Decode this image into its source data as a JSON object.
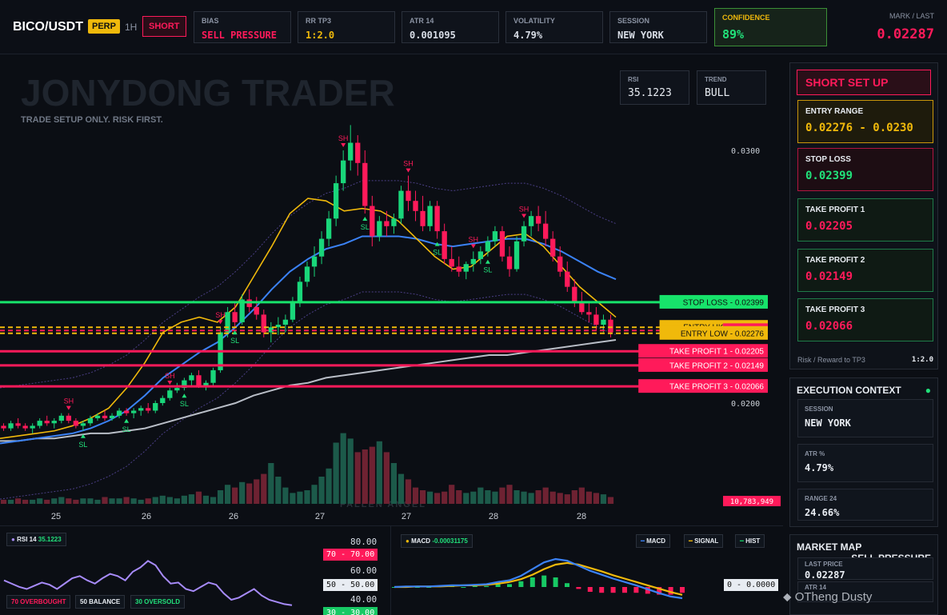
{
  "header": {
    "symbol": "BICO/USDT",
    "perp": "PERP",
    "timeframe": "1H",
    "side": "SHORT",
    "metrics": [
      {
        "label": "BIAS",
        "value": "SELL PRESSURE",
        "color": "#ff1a5a"
      },
      {
        "label": "RR TP3",
        "value": "1:2.0",
        "color": "#f0b90b"
      },
      {
        "label": "ATR 14",
        "value": "0.001095",
        "color": "#e8ecf2"
      },
      {
        "label": "VOLATILITY",
        "value": "4.79%",
        "color": "#e8ecf2"
      },
      {
        "label": "SESSION",
        "value": "NEW YORK",
        "color": "#e8ecf2"
      }
    ],
    "confidence_label": "CONFIDENCE",
    "confidence": "89%",
    "mark_label": "MARK / LAST",
    "mark": "0.02287"
  },
  "watermark": {
    "title": "JONYDONG TRADER",
    "subtitle": "TRADE SETUP ONLY. RISK FIRST.",
    "footer": "FALLEN ANGEL"
  },
  "overlay": {
    "rsi_label": "RSI",
    "rsi": "35.1223",
    "trend_label": "TREND",
    "trend": "BULL"
  },
  "chart_data": {
    "type": "candlestick",
    "y_ticks": [
      "0.0300",
      "0.0200"
    ],
    "x_ticks": [
      "25",
      "26",
      "26",
      "27",
      "27",
      "28",
      "28"
    ],
    "candles_ohlc": [
      [
        0.0191,
        0.0192,
        0.0189,
        0.019
      ],
      [
        0.019,
        0.0193,
        0.0189,
        0.0192
      ],
      [
        0.0192,
        0.0194,
        0.019,
        0.0191
      ],
      [
        0.0191,
        0.0192,
        0.0189,
        0.019
      ],
      [
        0.019,
        0.0192,
        0.0188,
        0.0191
      ],
      [
        0.0191,
        0.0194,
        0.019,
        0.0193
      ],
      [
        0.0193,
        0.0195,
        0.0191,
        0.0192
      ],
      [
        0.0192,
        0.0194,
        0.019,
        0.0193
      ],
      [
        0.0193,
        0.0196,
        0.0192,
        0.0195
      ],
      [
        0.0195,
        0.0196,
        0.0192,
        0.0193
      ],
      [
        0.0193,
        0.0194,
        0.019,
        0.0191
      ],
      [
        0.0191,
        0.0193,
        0.0189,
        0.0192
      ],
      [
        0.0192,
        0.0195,
        0.0191,
        0.0194
      ],
      [
        0.0194,
        0.0196,
        0.0193,
        0.0195
      ],
      [
        0.0195,
        0.0197,
        0.0193,
        0.0194
      ],
      [
        0.0194,
        0.0196,
        0.0193,
        0.0195
      ],
      [
        0.0195,
        0.0198,
        0.0194,
        0.0197
      ],
      [
        0.0197,
        0.0198,
        0.0195,
        0.0196
      ],
      [
        0.0196,
        0.0198,
        0.0194,
        0.0197
      ],
      [
        0.0197,
        0.0199,
        0.0195,
        0.0198
      ],
      [
        0.0198,
        0.02,
        0.0196,
        0.0197
      ],
      [
        0.0197,
        0.0201,
        0.0196,
        0.02
      ],
      [
        0.02,
        0.0203,
        0.0199,
        0.0202
      ],
      [
        0.0202,
        0.0206,
        0.0201,
        0.0205
      ],
      [
        0.0205,
        0.0208,
        0.0204,
        0.0206
      ],
      [
        0.0206,
        0.021,
        0.0205,
        0.0209
      ],
      [
        0.0209,
        0.0212,
        0.0207,
        0.0211
      ],
      [
        0.0211,
        0.0213,
        0.0206,
        0.0207
      ],
      [
        0.0207,
        0.0209,
        0.0205,
        0.0208
      ],
      [
        0.0208,
        0.0214,
        0.0207,
        0.0213
      ],
      [
        0.0213,
        0.023,
        0.0212,
        0.0228
      ],
      [
        0.0228,
        0.0238,
        0.0226,
        0.0236
      ],
      [
        0.0236,
        0.024,
        0.023,
        0.0232
      ],
      [
        0.0232,
        0.0243,
        0.0231,
        0.0241
      ],
      [
        0.0241,
        0.0245,
        0.0236,
        0.0238
      ],
      [
        0.0238,
        0.0242,
        0.0233,
        0.0235
      ],
      [
        0.0235,
        0.0237,
        0.0226,
        0.0228
      ],
      [
        0.0228,
        0.0232,
        0.0224,
        0.023
      ],
      [
        0.023,
        0.0234,
        0.0227,
        0.0231
      ],
      [
        0.0231,
        0.0235,
        0.0228,
        0.0233
      ],
      [
        0.0233,
        0.0242,
        0.0232,
        0.024
      ],
      [
        0.024,
        0.025,
        0.0238,
        0.0248
      ],
      [
        0.0248,
        0.0256,
        0.0246,
        0.0254
      ],
      [
        0.0254,
        0.0262,
        0.025,
        0.0258
      ],
      [
        0.0258,
        0.0268,
        0.0255,
        0.0265
      ],
      [
        0.0265,
        0.0276,
        0.0262,
        0.0273
      ],
      [
        0.0273,
        0.029,
        0.027,
        0.0287
      ],
      [
        0.0287,
        0.03,
        0.0284,
        0.0296
      ],
      [
        0.0296,
        0.031,
        0.0292,
        0.0303
      ],
      [
        0.0303,
        0.0306,
        0.029,
        0.0295
      ],
      [
        0.0295,
        0.03,
        0.0275,
        0.0278
      ],
      [
        0.0278,
        0.0282,
        0.0262,
        0.0266
      ],
      [
        0.0266,
        0.0274,
        0.0264,
        0.0272
      ],
      [
        0.0272,
        0.0276,
        0.0266,
        0.027
      ],
      [
        0.027,
        0.0275,
        0.0267,
        0.0273
      ],
      [
        0.0273,
        0.0286,
        0.0271,
        0.0284
      ],
      [
        0.0284,
        0.029,
        0.0276,
        0.028
      ],
      [
        0.028,
        0.0284,
        0.0272,
        0.0276
      ],
      [
        0.0276,
        0.0282,
        0.0268,
        0.027
      ],
      [
        0.027,
        0.028,
        0.0268,
        0.0278
      ],
      [
        0.0278,
        0.028,
        0.0265,
        0.0268
      ],
      [
        0.0268,
        0.0271,
        0.0255,
        0.0257
      ],
      [
        0.0257,
        0.0262,
        0.0252,
        0.0254
      ],
      [
        0.0254,
        0.0258,
        0.025,
        0.0252
      ],
      [
        0.0252,
        0.0256,
        0.0249,
        0.0255
      ],
      [
        0.0255,
        0.026,
        0.0252,
        0.0257
      ],
      [
        0.0257,
        0.0262,
        0.0255,
        0.026
      ],
      [
        0.026,
        0.0266,
        0.0258,
        0.0264
      ],
      [
        0.0264,
        0.027,
        0.0262,
        0.0268
      ],
      [
        0.0268,
        0.027,
        0.0256,
        0.0258
      ],
      [
        0.0258,
        0.0262,
        0.025,
        0.0253
      ],
      [
        0.0253,
        0.0266,
        0.0252,
        0.0264
      ],
      [
        0.0264,
        0.0272,
        0.0262,
        0.027
      ],
      [
        0.027,
        0.0276,
        0.0266,
        0.0274
      ],
      [
        0.0274,
        0.0278,
        0.0268,
        0.0271
      ],
      [
        0.0271,
        0.0276,
        0.0262,
        0.0265
      ],
      [
        0.0265,
        0.0268,
        0.0256,
        0.0258
      ],
      [
        0.0258,
        0.0262,
        0.025,
        0.0252
      ],
      [
        0.0252,
        0.0256,
        0.0244,
        0.0246
      ],
      [
        0.0246,
        0.0249,
        0.0238,
        0.024
      ],
      [
        0.024,
        0.0244,
        0.0235,
        0.0236
      ],
      [
        0.0236,
        0.024,
        0.0232,
        0.0235
      ],
      [
        0.0235,
        0.0238,
        0.0229,
        0.0231
      ],
      [
        0.0231,
        0.0235,
        0.0228,
        0.0233
      ],
      [
        0.0233,
        0.0235,
        0.0226,
        0.0228
      ]
    ],
    "ema_yellow": [
      0.0186,
      0.0187,
      0.0188,
      0.0189,
      0.0191,
      0.0194,
      0.0198,
      0.0206,
      0.0216,
      0.0228,
      0.0232,
      0.0234,
      0.0232,
      0.0238,
      0.025,
      0.0262,
      0.0275,
      0.0281,
      0.028,
      0.0276,
      0.0277,
      0.0276,
      0.0272,
      0.0265,
      0.0258,
      0.0253,
      0.0254,
      0.026,
      0.0266,
      0.0267,
      0.0262,
      0.0254,
      0.0246,
      0.024,
      0.0234
    ],
    "ema_blue": [
      0.0184,
      0.0185,
      0.0186,
      0.0187,
      0.0188,
      0.019,
      0.0193,
      0.0197,
      0.0203,
      0.021,
      0.0215,
      0.022,
      0.0224,
      0.023,
      0.0237,
      0.0245,
      0.0252,
      0.0257,
      0.0261,
      0.0263,
      0.0266,
      0.0266,
      0.0266,
      0.0265,
      0.0263,
      0.0262,
      0.0263,
      0.0264,
      0.0265,
      0.0265,
      0.0263,
      0.026,
      0.0256,
      0.0252,
      0.0249
    ],
    "ema_gray": [
      0.0185,
      0.0185,
      0.0186,
      0.0186,
      0.0187,
      0.0188,
      0.0188,
      0.0189,
      0.019,
      0.0192,
      0.0194,
      0.0196,
      0.0198,
      0.02,
      0.0203,
      0.0205,
      0.0207,
      0.0208,
      0.021,
      0.0211,
      0.0212,
      0.0213,
      0.0214,
      0.0215,
      0.0216,
      0.0217,
      0.0218,
      0.0219,
      0.0219,
      0.022,
      0.0221,
      0.0222,
      0.0223,
      0.0224,
      0.0225
    ],
    "levels": [
      {
        "label": "STOP LOSS",
        "value": 0.02399,
        "text": "0.02399",
        "color": "#17e36b",
        "style": "solid"
      },
      {
        "label": "ENTRY HIGH",
        "value": 0.023,
        "text": "0.0230",
        "color": "#f0b90b",
        "style": "dashed"
      },
      {
        "label": "",
        "value": 0.02287,
        "text": "0.02287",
        "color": "#ff1a5a",
        "style": "dashed"
      },
      {
        "label": "ENTRY LOW",
        "value": 0.02276,
        "text": "0.02276",
        "color": "#f0b90b",
        "style": "dashed"
      },
      {
        "label": "TAKE PROFIT 1",
        "value": 0.02205,
        "text": "0.02205",
        "color": "#ff1a5a",
        "style": "solid"
      },
      {
        "label": "TAKE PROFIT 2",
        "value": 0.02149,
        "text": "0.02149",
        "color": "#ff1a5a",
        "style": "solid"
      },
      {
        "label": "TAKE PROFIT 3",
        "value": 0.02066,
        "text": "0.02066",
        "color": "#ff1a5a",
        "style": "solid"
      }
    ],
    "marker_labels": {
      "high": "SH",
      "low": "SL"
    },
    "volume_label": "10,783,949",
    "volume": [
      3,
      3,
      4,
      3,
      3,
      4,
      3,
      4,
      5,
      4,
      3,
      4,
      4,
      3,
      5,
      4,
      4,
      5,
      4,
      3,
      4,
      5,
      6,
      5,
      4,
      6,
      7,
      9,
      6,
      5,
      10,
      14,
      12,
      16,
      15,
      18,
      22,
      30,
      20,
      12,
      8,
      9,
      10,
      14,
      20,
      26,
      45,
      52,
      48,
      38,
      40,
      42,
      46,
      38,
      30,
      22,
      18,
      12,
      10,
      9,
      8,
      9,
      14,
      10,
      8,
      9,
      12,
      10,
      9,
      12,
      14,
      10,
      9,
      8,
      10,
      12,
      9,
      8,
      7,
      10,
      12,
      9,
      8,
      7,
      5
    ]
  },
  "rsi_panel": {
    "title": "RSI 14",
    "value": "35.1223",
    "ticks": [
      "80.00",
      "60.00",
      "40.00"
    ],
    "tag70": "70",
    "tag70v": "70.00",
    "tag50": "50",
    "tag50v": "50.00",
    "tag30": "30",
    "tag30v": "30.00",
    "btn_ob": "70 OVERBOUGHT",
    "btn_bal": "50 BALANCE",
    "btn_os": "30 OVERSOLD",
    "values": [
      58,
      55,
      52,
      50,
      53,
      56,
      54,
      50,
      55,
      60,
      62,
      58,
      55,
      60,
      64,
      62,
      58,
      66,
      70,
      76,
      72,
      62,
      55,
      56,
      50,
      48,
      52,
      56,
      54,
      46,
      40,
      42,
      46,
      50,
      44,
      40,
      38,
      36,
      35
    ]
  },
  "macd_panel": {
    "title": "MACD",
    "value": "-0.00031175",
    "legend": [
      "MACD",
      "SIGNAL",
      "HIST"
    ],
    "zero_tag": "0",
    "zero_val": "0.0000",
    "macd": [
      0,
      0.1,
      0.1,
      0.1,
      0.2,
      0.3,
      0.3,
      0.4,
      0.5,
      0.9,
      1.2,
      2.0,
      3.2,
      4.4,
      5.0,
      4.7,
      3.8,
      2.9,
      2.2,
      1.5,
      0.9,
      0.3,
      -0.4,
      -1.1,
      -1.7,
      -2.0
    ],
    "signal": [
      0,
      0,
      0.1,
      0.1,
      0.1,
      0.2,
      0.3,
      0.3,
      0.4,
      0.6,
      0.9,
      1.4,
      2.2,
      3.2,
      4.0,
      4.3,
      4.0,
      3.4,
      2.8,
      2.1,
      1.5,
      0.9,
      0.3,
      -0.3,
      -0.9,
      -1.4
    ]
  },
  "watermark_logo": "OTheng Dusty",
  "panel": {
    "title": "SHORT SET UP",
    "cards": [
      {
        "label": "ENTRY RANGE",
        "value": "0.02276 - 0.0230"
      },
      {
        "label": "STOP LOSS",
        "value": "0.02399"
      },
      {
        "label": "TAKE PROFIT 1",
        "value": "0.02205"
      },
      {
        "label": "TAKE PROFIT 2",
        "value": "0.02149"
      },
      {
        "label": "TAKE PROFIT 3",
        "value": "0.02066"
      }
    ],
    "rr_label": "Risk / Reward to TP3",
    "rr_value": "1:2.0"
  },
  "context": {
    "title": "EXECUTION CONTEXT",
    "items": [
      {
        "label": "SESSION",
        "value": "NEW YORK"
      },
      {
        "label": "ATR %",
        "value": "4.79%"
      },
      {
        "label": "RANGE 24",
        "value": "24.66%"
      }
    ]
  },
  "market": {
    "title": "MARKET MAP",
    "bias": "SELL PRESSURE",
    "items": [
      {
        "label": "LAST PRICE",
        "value": "0.02287"
      },
      {
        "label": "ATR 14",
        "value": ""
      }
    ]
  }
}
